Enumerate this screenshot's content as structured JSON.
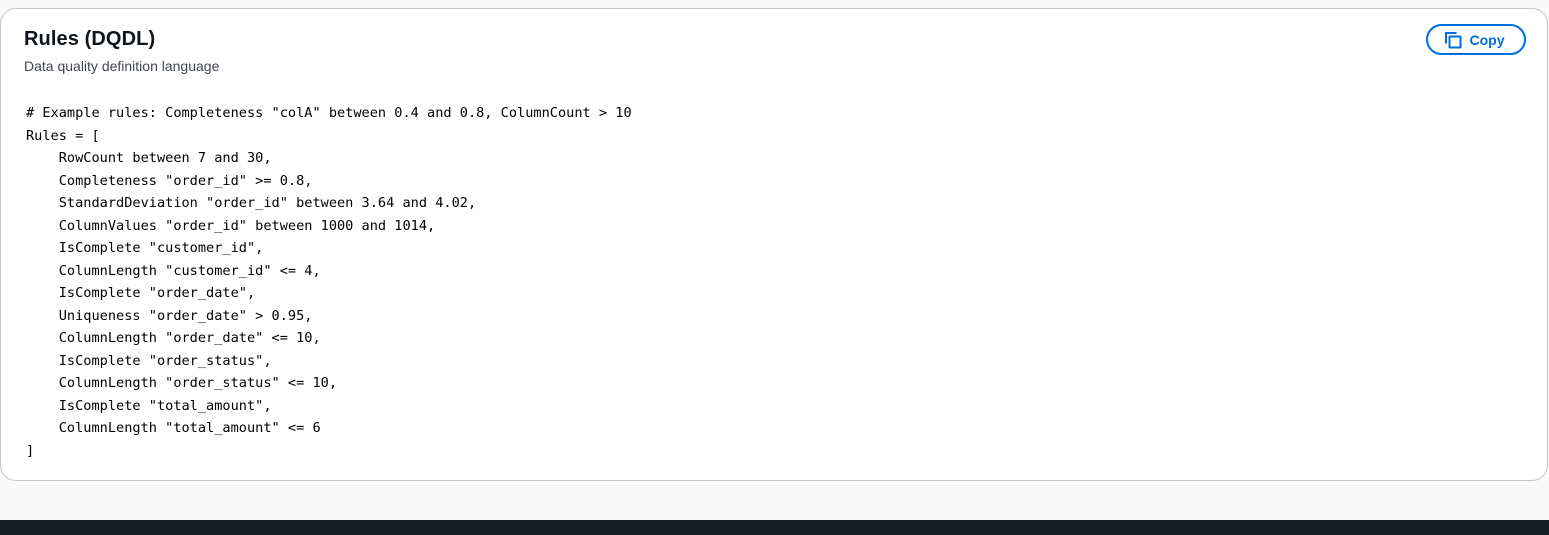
{
  "panel": {
    "title": "Rules (DQDL)",
    "description": "Data quality definition language",
    "copy_label": "Copy",
    "copy_icon": "copy-icon"
  },
  "code": {
    "lines": [
      "# Example rules: Completeness \"colA\" between 0.4 and 0.8, ColumnCount > 10",
      "Rules = [",
      "    RowCount between 7 and 30,",
      "    Completeness \"order_id\" >= 0.8,",
      "    StandardDeviation \"order_id\" between 3.64 and 4.02,",
      "    ColumnValues \"order_id\" between 1000 and 1014,",
      "    IsComplete \"customer_id\",",
      "    ColumnLength \"customer_id\" <= 4,",
      "    IsComplete \"order_date\",",
      "    Uniqueness \"order_date\" > 0.95,",
      "    ColumnLength \"order_date\" <= 10,",
      "    IsComplete \"order_status\",",
      "    ColumnLength \"order_status\" <= 10,",
      "    IsComplete \"total_amount\",",
      "    ColumnLength \"total_amount\" <= 6",
      "]"
    ]
  },
  "colors": {
    "accent": "#006ce0",
    "footer": "#161d26",
    "panel_border": "#c6c6cd"
  }
}
